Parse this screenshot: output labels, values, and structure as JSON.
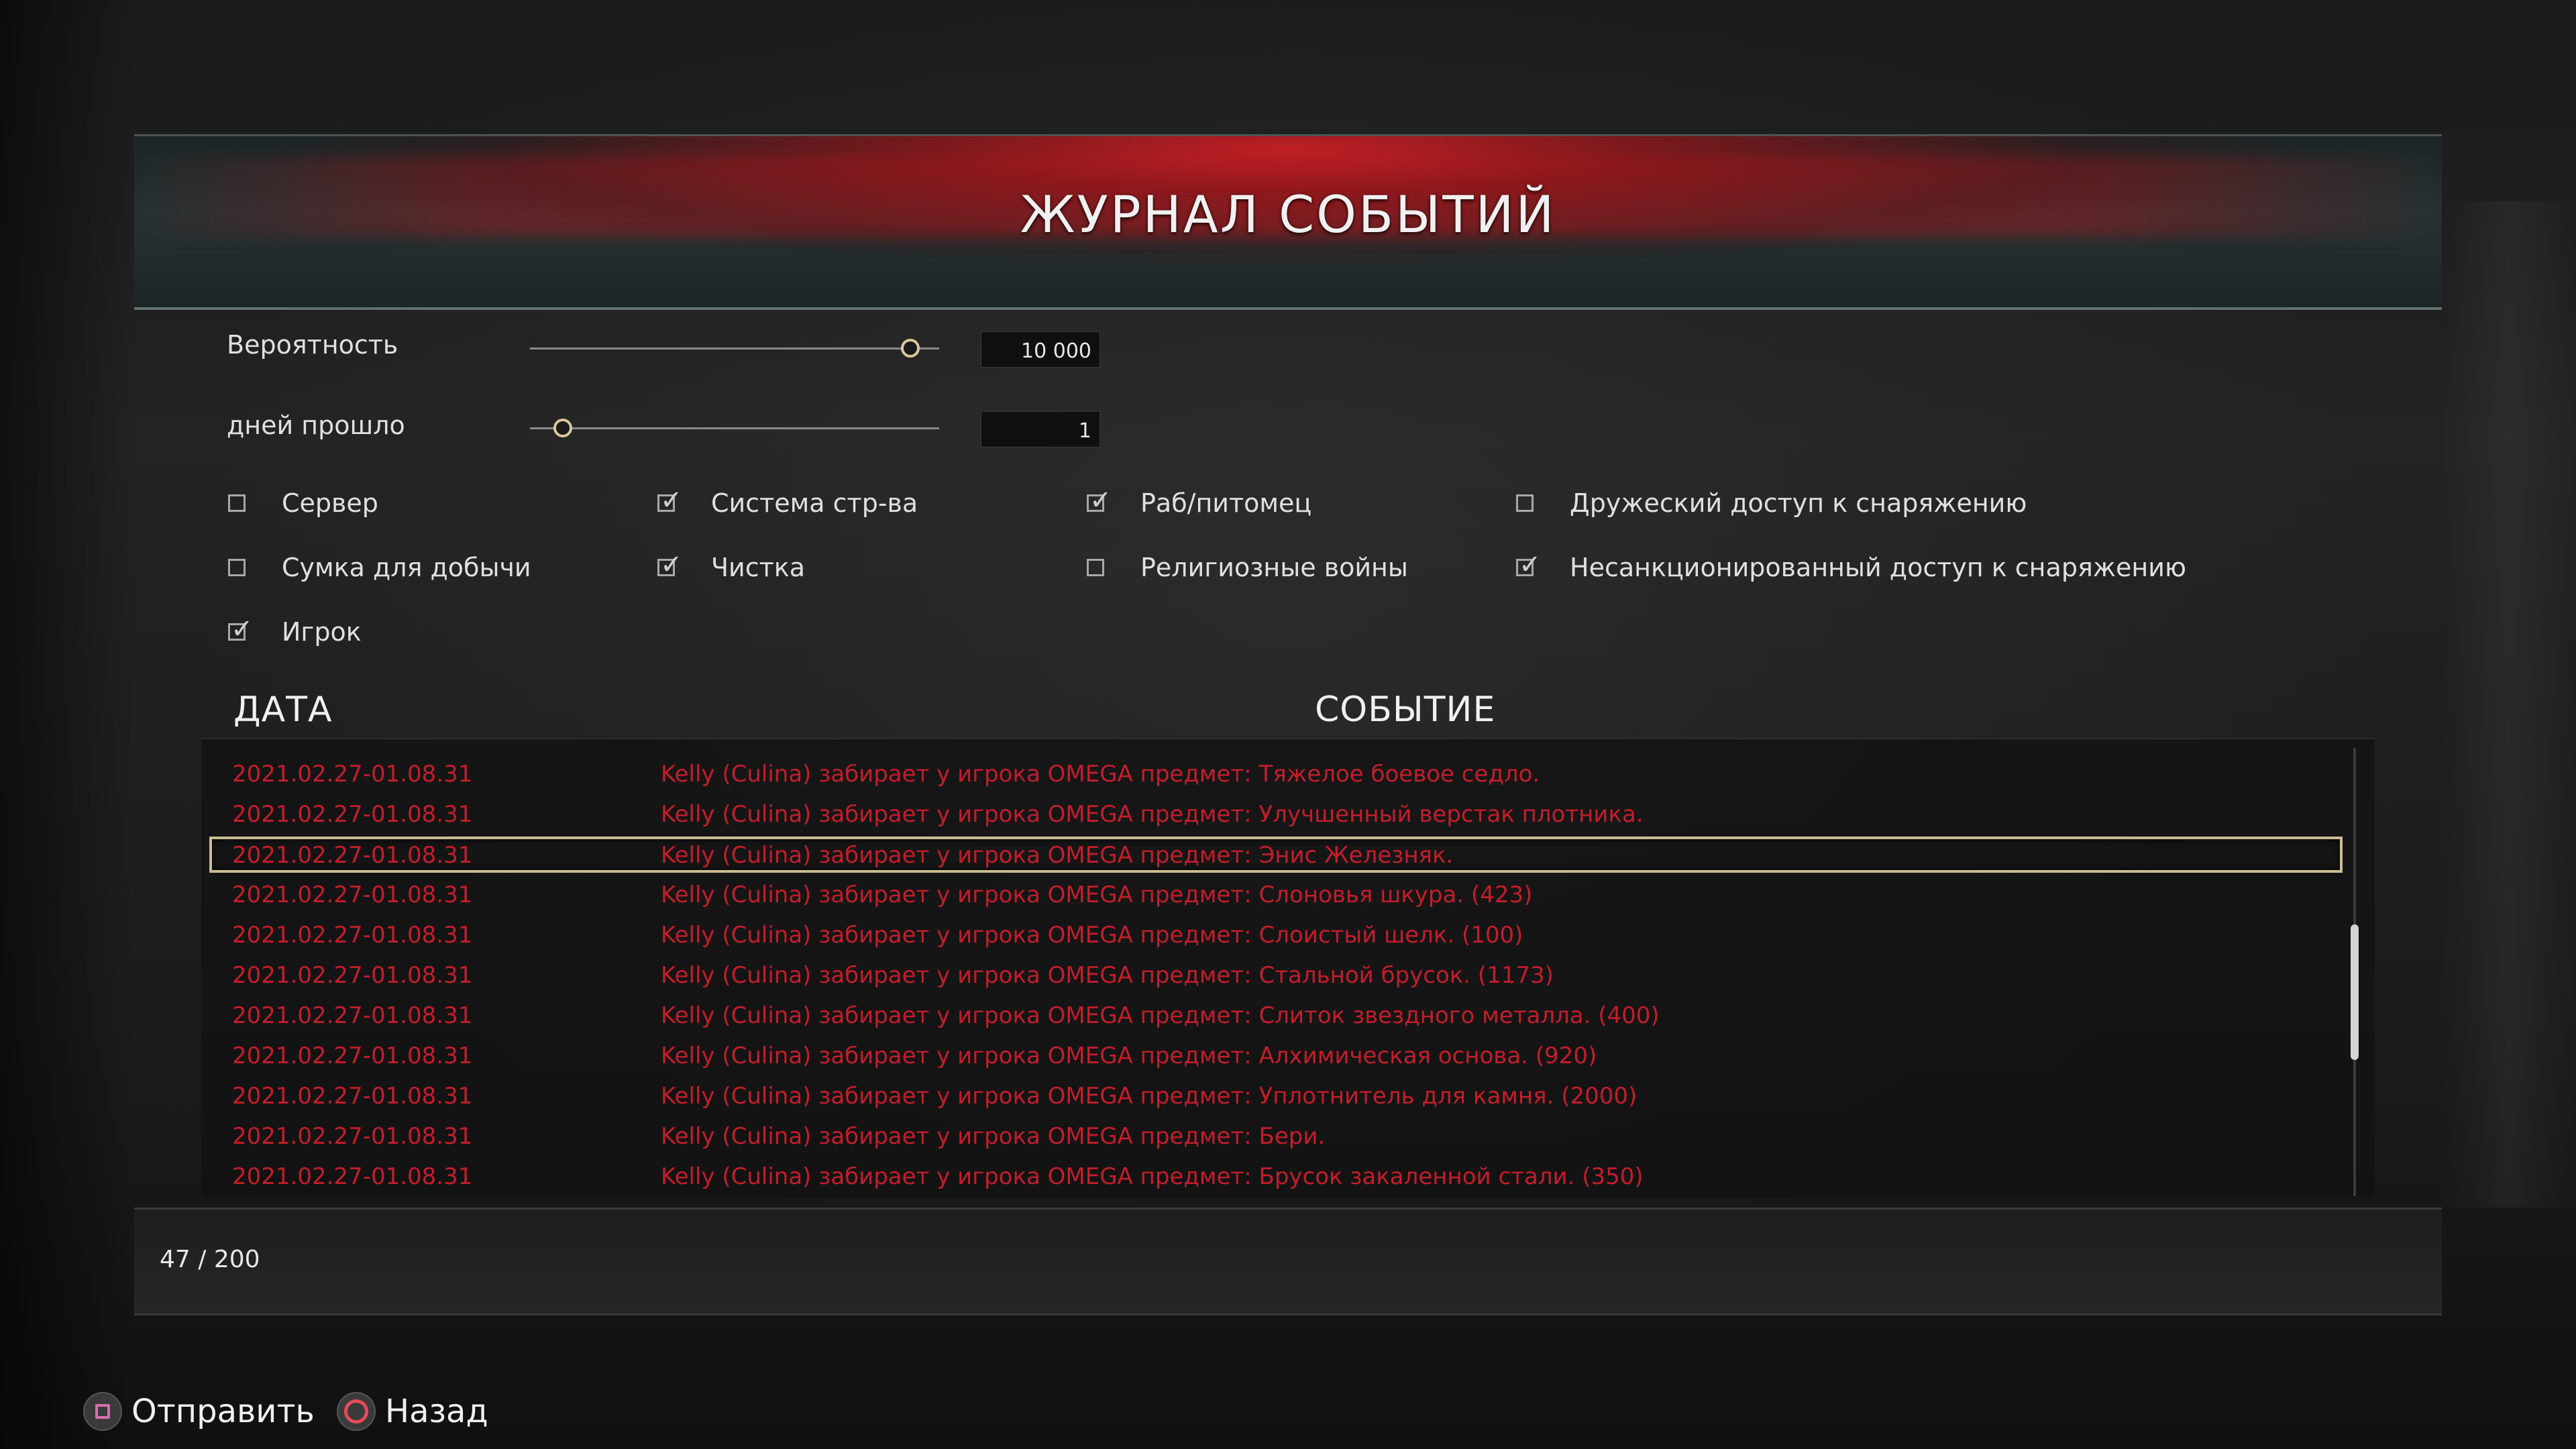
{
  "header": {
    "title": "ЖУРНАЛ СОБЫТИЙ"
  },
  "sliders": [
    {
      "label": "Вероятность",
      "value": "10 000",
      "level": 0.93
    },
    {
      "label": "дней прошло",
      "value": "1",
      "level": 0.08
    }
  ],
  "filters": [
    {
      "label": "Сервер",
      "checked": false
    },
    {
      "label": "Система стр-ва",
      "checked": true
    },
    {
      "label": "Раб/питомец",
      "checked": true
    },
    {
      "label": "Дружеский доступ к снаряжению",
      "checked": false
    },
    {
      "label": "Сумка для добычи",
      "checked": false
    },
    {
      "label": "Чистка",
      "checked": true
    },
    {
      "label": "Религиозные войны",
      "checked": false
    },
    {
      "label": "Несанкционированный доступ к снаряжению",
      "checked": true
    },
    {
      "label": "Игрок",
      "checked": true
    }
  ],
  "table": {
    "columns": {
      "date": "ДАТА",
      "event": "СОБЫТИЕ"
    },
    "selected_index": 2,
    "rows": [
      {
        "date": "2021.02.27-01.08.31",
        "event": "Kelly (Culina) забирает у игрока OMEGA предмет: Тяжелое боевое седло."
      },
      {
        "date": "2021.02.27-01.08.31",
        "event": "Kelly (Culina) забирает у игрока OMEGA предмет: Улучшенный верстак плотника."
      },
      {
        "date": "2021.02.27-01.08.31",
        "event": "Kelly (Culina) забирает у игрока OMEGA предмет: Энис Железняк."
      },
      {
        "date": "2021.02.27-01.08.31",
        "event": "Kelly (Culina) забирает у игрока OMEGA предмет: Слоновья шкура. (423)"
      },
      {
        "date": "2021.02.27-01.08.31",
        "event": "Kelly (Culina) забирает у игрока OMEGA предмет: Слоистый шелк. (100)"
      },
      {
        "date": "2021.02.27-01.08.31",
        "event": "Kelly (Culina) забирает у игрока OMEGA предмет: Стальной брусок. (1173)"
      },
      {
        "date": "2021.02.27-01.08.31",
        "event": "Kelly (Culina) забирает у игрока OMEGA предмет: Слиток звездного металла. (400)"
      },
      {
        "date": "2021.02.27-01.08.31",
        "event": "Kelly (Culina) забирает у игрока OMEGA предмет: Алхимическая основа. (920)"
      },
      {
        "date": "2021.02.27-01.08.31",
        "event": "Kelly (Culina) забирает у игрока OMEGA предмет: Уплотнитель для камня. (2000)"
      },
      {
        "date": "2021.02.27-01.08.31",
        "event": "Kelly (Culina) забирает у игрока OMEGA предмет: Бери."
      },
      {
        "date": "2021.02.27-01.08.31",
        "event": "Kelly (Culina) забирает у игрока OMEGA предмет: Брусок закаленной стали. (350)"
      }
    ]
  },
  "footer": {
    "page_count": "47 / 200"
  },
  "buttons": {
    "send": {
      "label": "Отправить",
      "icon": "square-button-icon"
    },
    "back": {
      "label": "Назад",
      "icon": "circle-button-icon"
    }
  },
  "colors": {
    "event_text": "#c41d2c",
    "selection_border": "#cbbd92",
    "banner_red": "#c81e23"
  }
}
